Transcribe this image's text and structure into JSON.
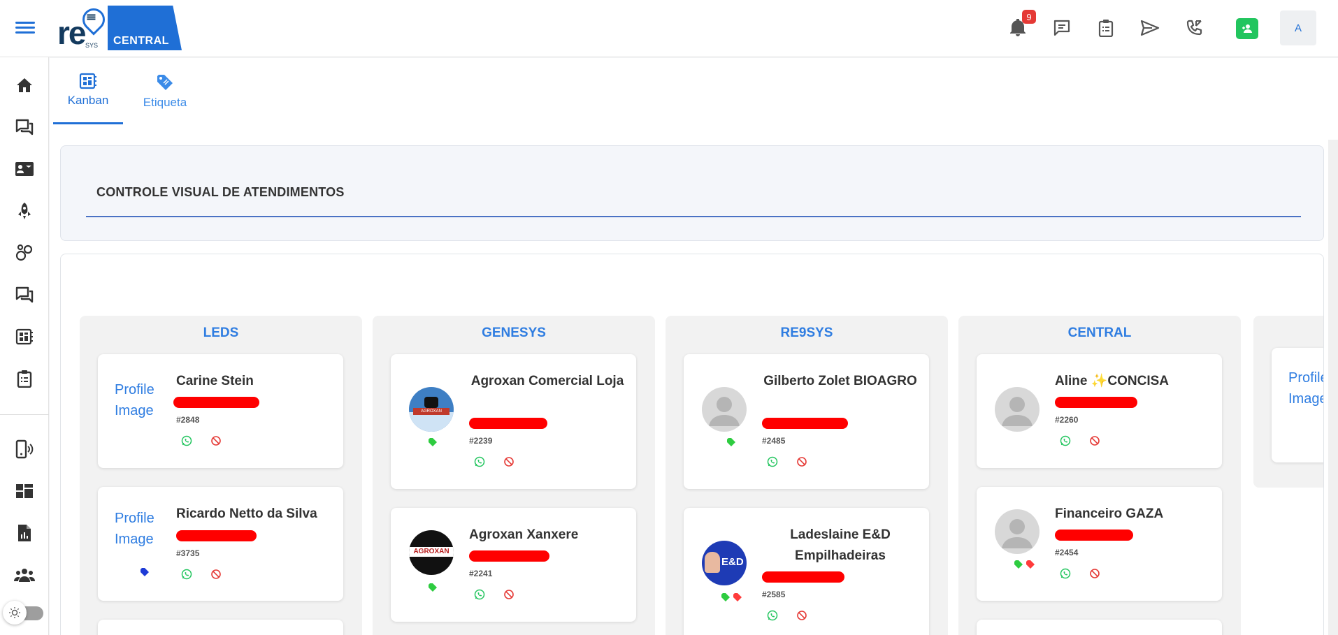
{
  "app": {
    "logo_re": "re",
    "logo_sys": "SYS",
    "logo_central": "CENTRAL"
  },
  "topbar": {
    "notification_count": "9",
    "user_initial": "A"
  },
  "tabs": [
    {
      "label": "Kanban"
    },
    {
      "label": "Etiqueta"
    }
  ],
  "header": {
    "title": "CONTROLE VISUAL DE ATENDIMENTOS"
  },
  "broken_image_alt": "Profile Image",
  "columns": [
    {
      "title": "LEDS",
      "cards": [
        {
          "name": "Carine Stein",
          "id": "#2848"
        },
        {
          "name": "Ricardo Netto da Silva",
          "id": "#3735"
        }
      ]
    },
    {
      "title": "GENESYS",
      "cards": [
        {
          "name": "Agroxan Comercial Loja",
          "id": "#2239",
          "avatar_text": "AGROXAN"
        },
        {
          "name": "Agroxan Xanxere",
          "id": "#2241",
          "avatar_text": "AGROXAN"
        }
      ]
    },
    {
      "title": "RE9SYS",
      "cards": [
        {
          "name": "Gilberto Zolet BIOAGRO",
          "id": "#2485"
        },
        {
          "name": "Ladeslaine E&D Empilhadeiras",
          "id": "#2585",
          "avatar_text": "E&D"
        }
      ]
    },
    {
      "title": "CENTRAL",
      "cards": [
        {
          "name": "Aline ✨CONCISA",
          "id": "#2260"
        },
        {
          "name": "Financeiro GAZA",
          "id": "#2454"
        }
      ]
    }
  ],
  "colors": {
    "primary": "#1f6fd6",
    "column_title": "#2f7de1",
    "whatsapp_green": "#22c55e",
    "block_red": "#e53935",
    "tag_green": "#2ecc40",
    "tag_red": "#ff3b3b",
    "tag_blue": "#1e3bd6"
  }
}
